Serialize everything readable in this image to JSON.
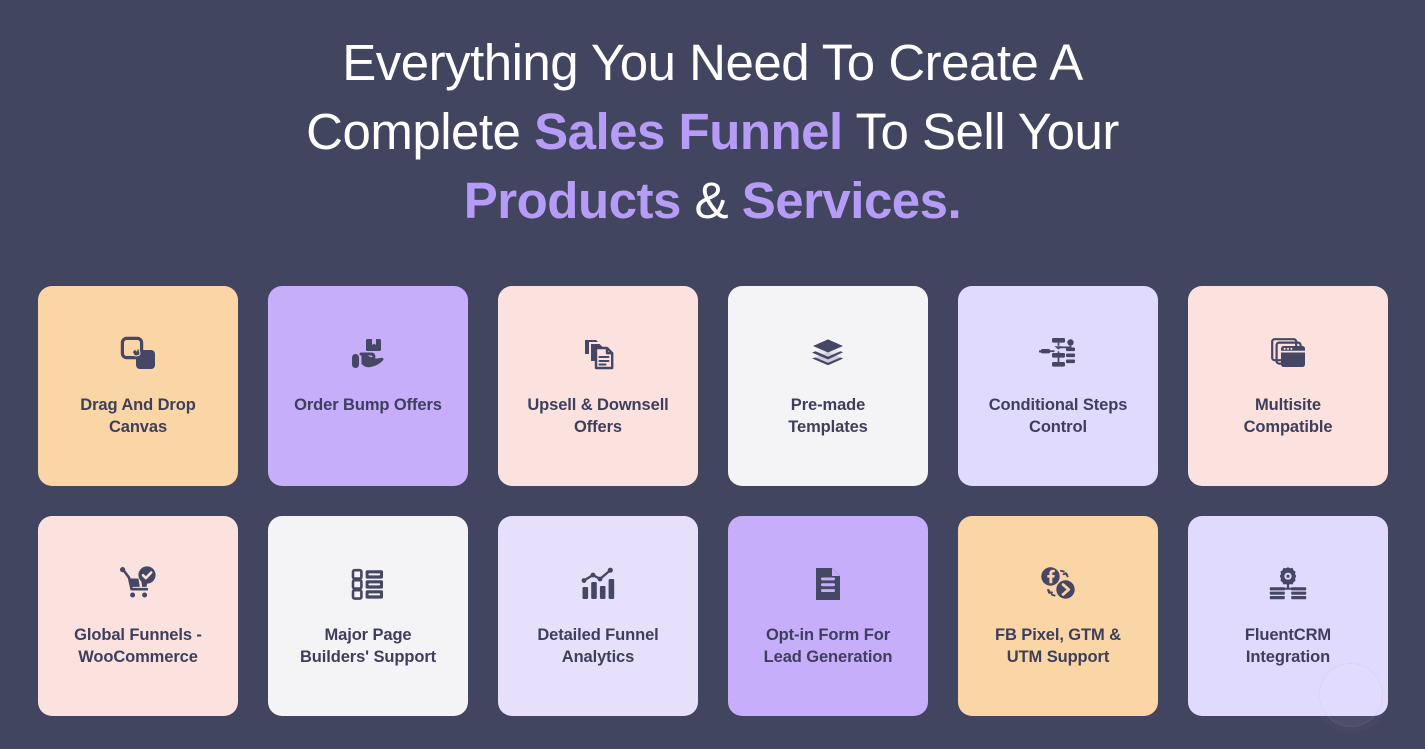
{
  "theme": {
    "background": "#42455f",
    "heading_text_color": "#ffffff",
    "heading_accent_color": "#b79cf7",
    "card_label_color": "#3d3f5c",
    "icon_color": "#454764"
  },
  "heading": {
    "line1": "Everything You Need To Create A",
    "line2_pre": "Complete ",
    "line2_accent": "Sales Funnel",
    "line2_post": " To Sell Your",
    "line3_accent1": "Products",
    "line3_mid": " & ",
    "line3_accent2": "Services.",
    "full_text": "Everything You Need To Create A Complete Sales Funnel To Sell Your Products & Services."
  },
  "features": [
    {
      "label": "Drag And Drop\nCanvas",
      "bg": "#fad5a5",
      "icon": "drag-and-drop-icon"
    },
    {
      "label": "Order Bump Offers",
      "bg": "#c6aefb",
      "icon": "hand-holding-box-icon"
    },
    {
      "label": "Upsell & Downsell\nOffers",
      "bg": "#fbe2df",
      "icon": "documents-stack-icon"
    },
    {
      "label": "Pre-made\nTemplates",
      "bg": "#f4f4f6",
      "icon": "layers-icon"
    },
    {
      "label": "Conditional Steps\nControl",
      "bg": "#e0daff",
      "icon": "flowchart-icon"
    },
    {
      "label": "Multisite\nCompatible",
      "bg": "#fbe2df",
      "icon": "browser-windows-icon"
    },
    {
      "label": "Global Funnels -\nWooCommerce",
      "bg": "#fbe2df",
      "icon": "cart-check-icon"
    },
    {
      "label": "Major Page\nBuilders' Support",
      "bg": "#f4f4f6",
      "icon": "list-layout-icon"
    },
    {
      "label": "Detailed Funnel\nAnalytics",
      "bg": "#e6e0fb",
      "icon": "bar-chart-trend-icon"
    },
    {
      "label": "Opt-in Form For\nLead Generation",
      "bg": "#c6aefb",
      "icon": "form-document-icon"
    },
    {
      "label": "FB Pixel, GTM &\nUTM Support",
      "bg": "#fad5a5",
      "icon": "facebook-tag-manager-icon"
    },
    {
      "label": "FluentCRM\nIntegration",
      "bg": "#e0daff",
      "icon": "gear-server-icon"
    }
  ],
  "chat_widget": {
    "name": "chat-launcher-bubble"
  }
}
